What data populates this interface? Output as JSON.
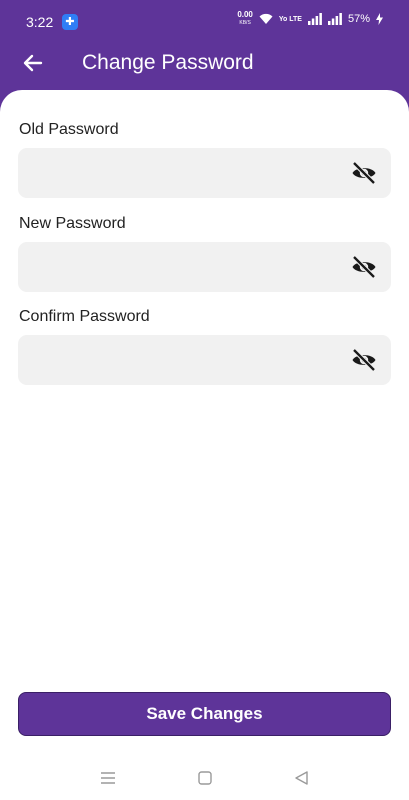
{
  "status_bar": {
    "time": "3:22",
    "notification_glyph": "✚",
    "net_speed": "0.00",
    "net_unit": "KB/S",
    "volte": "Yo LTE",
    "battery": "57%"
  },
  "app_bar": {
    "title": "Change Password",
    "back_icon": "arrow-left-icon"
  },
  "form": {
    "old_password": {
      "label": "Old Password",
      "value": "",
      "placeholder": ""
    },
    "new_password": {
      "label": "New Password",
      "value": "",
      "placeholder": ""
    },
    "confirm_password": {
      "label": "Confirm Password",
      "value": "",
      "placeholder": ""
    },
    "toggle_icon": "eye-off-icon"
  },
  "actions": {
    "save_label": "Save Changes"
  },
  "colors": {
    "primary": "#5e3499",
    "field_bg": "#f1f1f1",
    "text": "#222222"
  },
  "nav_bar": {
    "icons": [
      "menu-icon",
      "home-square-icon",
      "back-triangle-icon"
    ]
  }
}
